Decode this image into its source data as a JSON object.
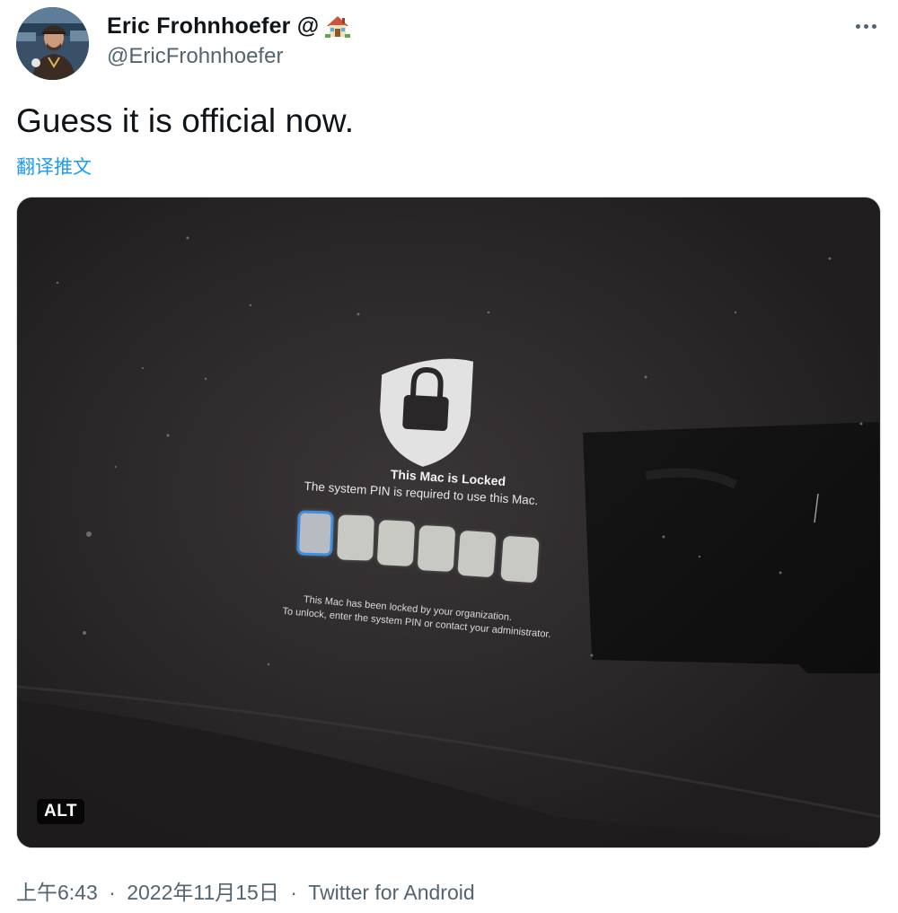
{
  "author": {
    "name": "Eric Frohnhoefer @",
    "handle": "@EricFrohnhoefer",
    "name_icon": "house-emoji-icon"
  },
  "tweet": {
    "text": "Guess it is official now.",
    "translate_label": "翻译推文"
  },
  "media": {
    "alt_badge": "ALT",
    "screen": {
      "title": "This Mac is Locked",
      "subtitle": "The system PIN is required to use this Mac.",
      "pin_length": 6,
      "message_line1": "This Mac has been locked by your organization.",
      "message_line2": "To unlock, enter the system PIN or contact your administrator."
    }
  },
  "meta": {
    "time": "上午6:43",
    "date": "2022年11月15日",
    "source": "Twitter for Android",
    "separator": "·"
  },
  "colors": {
    "link": "#1d9bf0",
    "secondary_text": "#536471",
    "pin_focus": "#3e8de0"
  }
}
